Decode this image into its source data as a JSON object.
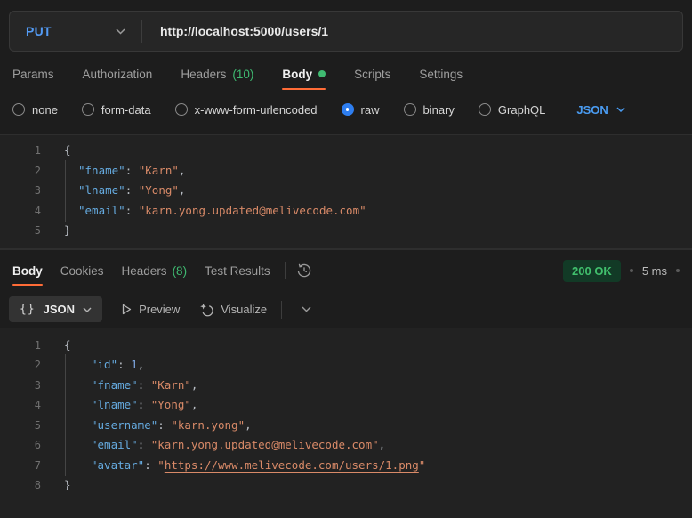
{
  "request": {
    "method": "PUT",
    "url": "http://localhost:5000/users/1",
    "tabs": {
      "params": "Params",
      "authorization": "Authorization",
      "headers": "Headers",
      "headers_count": "(10)",
      "body": "Body",
      "scripts": "Scripts",
      "settings": "Settings"
    },
    "body_types": {
      "none": "none",
      "form_data": "form-data",
      "urlencoded": "x-www-form-urlencoded",
      "raw": "raw",
      "binary": "binary",
      "graphql": "GraphQL"
    },
    "selected_body_type": "raw",
    "language": "JSON",
    "editor": {
      "l1": {
        "num": "1",
        "open": "{"
      },
      "l2": {
        "num": "2",
        "key": "\"fname\"",
        "colon": ": ",
        "value": "\"Karn\"",
        "comma": ","
      },
      "l3": {
        "num": "3",
        "key": "\"lname\"",
        "colon": ": ",
        "value": "\"Yong\"",
        "comma": ","
      },
      "l4": {
        "num": "4",
        "key": "\"email\"",
        "colon": ": ",
        "value": "\"karn.yong.updated@melivecode.com\"",
        "comma": ""
      },
      "l5": {
        "num": "5",
        "close": "}"
      }
    }
  },
  "response": {
    "tabs": {
      "body": "Body",
      "cookies": "Cookies",
      "headers": "Headers",
      "headers_count": "(8)",
      "test_results": "Test Results"
    },
    "status": "200 OK",
    "time": "5 ms",
    "toolbar": {
      "braces": "{}",
      "format": "JSON",
      "preview": "Preview",
      "visualize": "Visualize"
    },
    "editor": {
      "l1": {
        "num": "1",
        "open": "{"
      },
      "l2": {
        "num": "2",
        "key": "\"id\"",
        "colon": ": ",
        "value": "1",
        "comma": ","
      },
      "l3": {
        "num": "3",
        "key": "\"fname\"",
        "colon": ": ",
        "value": "\"Karn\"",
        "comma": ","
      },
      "l4": {
        "num": "4",
        "key": "\"lname\"",
        "colon": ": ",
        "value": "\"Yong\"",
        "comma": ","
      },
      "l5": {
        "num": "5",
        "key": "\"username\"",
        "colon": ": ",
        "value": "\"karn.yong\"",
        "comma": ","
      },
      "l6": {
        "num": "6",
        "key": "\"email\"",
        "colon": ": ",
        "value": "\"karn.yong.updated@melivecode.com\"",
        "comma": ","
      },
      "l7": {
        "num": "7",
        "key": "\"avatar\"",
        "colon": ": ",
        "quote_open": "\"",
        "link": "https://www.melivecode.com/users/1.png",
        "quote_close": "\""
      },
      "l8": {
        "num": "8",
        "close": "}"
      }
    }
  },
  "colors": {
    "accent_orange": "#ff6c37",
    "method_blue": "#539bf5",
    "success_green": "#3fba71",
    "status_badge_bg": "#123a26",
    "string_token": "#d98a68",
    "key_token": "#65aadf"
  }
}
